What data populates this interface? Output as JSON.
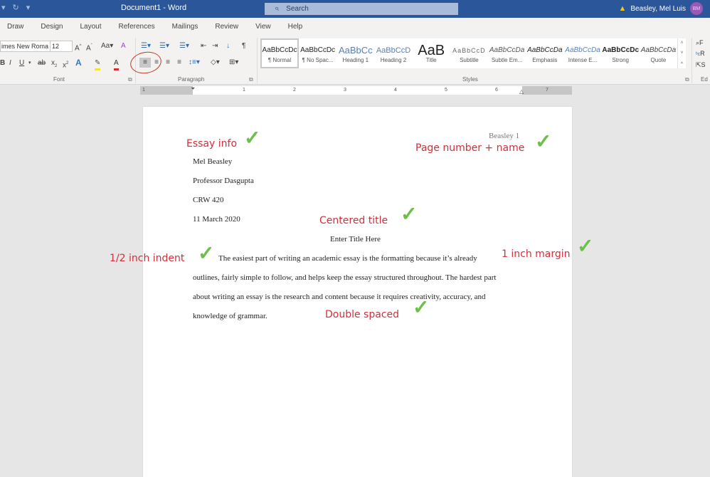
{
  "titlebar": {
    "doc_title": "Document1  -  Word",
    "search_placeholder": "Search",
    "user_name": "Beasley, Mel Luis",
    "user_initials": "BM"
  },
  "tabs": [
    "Draw",
    "Design",
    "Layout",
    "References",
    "Mailings",
    "Review",
    "View",
    "Help"
  ],
  "font_group": {
    "font_name": "imes New Roma",
    "font_size": "12",
    "label": "Font"
  },
  "paragraph_group": {
    "label": "Paragraph"
  },
  "styles_group": {
    "label": "Styles",
    "items": [
      {
        "preview": "AaBbCcDc",
        "name": "¶ Normal"
      },
      {
        "preview": "AaBbCcDc",
        "name": "¶ No Spac..."
      },
      {
        "preview": "AaBbCc",
        "name": "Heading 1"
      },
      {
        "preview": "AaBbCcD",
        "name": "Heading 2"
      },
      {
        "preview": "AaB",
        "name": "Title"
      },
      {
        "preview": "AaBbCcD",
        "name": "Subtitle"
      },
      {
        "preview": "AaBbCcDa",
        "name": "Subtle Em..."
      },
      {
        "preview": "AaBbCcDa",
        "name": "Emphasis"
      },
      {
        "preview": "AaBbCcDa",
        "name": "Intense E..."
      },
      {
        "preview": "AaBbCcDc",
        "name": "Strong"
      },
      {
        "preview": "AaBbCcDa",
        "name": "Quote"
      }
    ]
  },
  "editing_group": {
    "label": "Ed",
    "find": "F",
    "replace": "R",
    "select": "S"
  },
  "ruler": {
    "numbers": [
      "1",
      "1",
      "2",
      "3",
      "4",
      "5",
      "6",
      "7"
    ]
  },
  "document": {
    "header": "Beasley 1",
    "info_lines": [
      "Mel Beasley",
      "Professor Dasgupta",
      "CRW 420",
      "11 March 2020"
    ],
    "title": "Enter Title Here",
    "body_lines": [
      "The easiest part of writing an academic essay is the formatting because it’s already",
      "outlines, fairly simple to follow, and helps keep the essay structured throughout. The hardest part",
      "about writing an essay is the research and content because it requires creativity, accuracy, and",
      "knowledge of grammar."
    ]
  },
  "annotations": {
    "essay_info": "Essay info",
    "page_number": "Page number + name",
    "centered_title": "Centered title",
    "half_inch_indent": "1/2 inch indent",
    "one_inch_margin": "1 inch margin",
    "double_spaced": "Double spaced"
  },
  "colors": {
    "titlebar": "#2b579a",
    "annotation_text": "#d12f3a",
    "checkmark": "#6cc04a"
  }
}
